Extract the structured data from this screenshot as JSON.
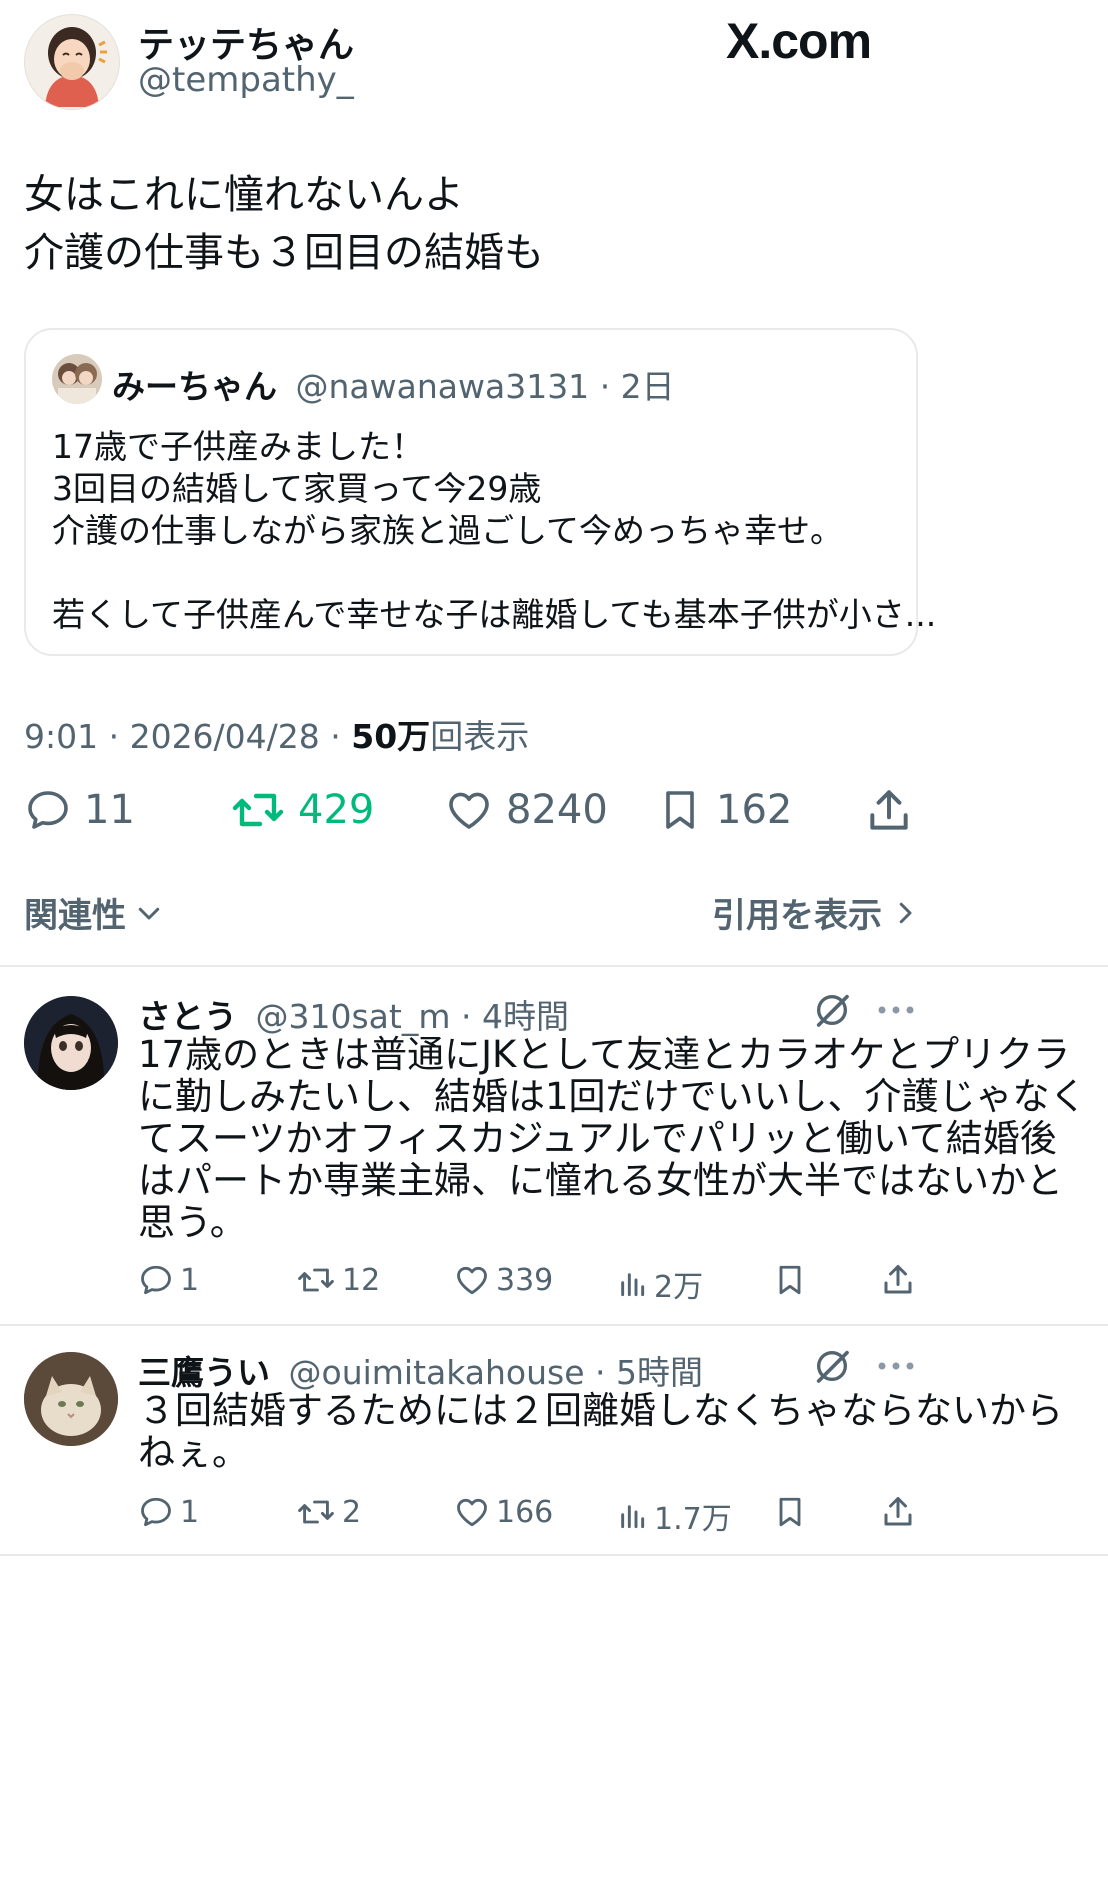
{
  "brand": {
    "logo_text": "X.com"
  },
  "post": {
    "author": {
      "name": "テッテちゃん",
      "handle": "@tempathy_"
    },
    "text_lines": [
      "女はこれに憧れないんよ",
      "介護の仕事も３回目の結婚も"
    ],
    "quote": {
      "name": "みーちゃん",
      "handle": "@nawanawa3131",
      "time": "· 2日",
      "lines": [
        "17歳で子供産みました！",
        "3回目の結婚して家買って今29歳",
        "介護の仕事しながら家族と過ごして今めっちゃ幸せ。",
        "若くして子供産んで幸せな子は離婚しても基本子供が小さ..."
      ]
    },
    "timestamp": "9:01 · 2026/04/28 · ",
    "views_count": "50万",
    "views_label": "回表示",
    "stats": {
      "replies": "11",
      "reposts": "429",
      "likes": "8240",
      "bookmarks": "162"
    },
    "sort_label": "関連性",
    "quotes_link": "引用を表示"
  },
  "replies": [
    {
      "name": "さとう",
      "handle": "@310sat_m",
      "time": "· 4時間",
      "lines": [
        "17歳のときは普通にJKとして友達とカラオケとプリクラ",
        "に勤しみたいし、結婚は1回だけでいいし、介護じゃなく",
        "てスーツかオフィスカジュアルでパリッと働いて結婚後",
        "はパートか専業主婦、に憧れる女性が大半ではないかと",
        "思う。"
      ],
      "stats": {
        "replies": "1",
        "reposts": "12",
        "likes": "339",
        "views": "2万"
      }
    },
    {
      "name": "三鷹うい",
      "handle": "@ouimitakahouse",
      "time": "· 5時間",
      "lines": [
        "３回結婚するためには２回離婚しなくちゃならないから",
        "ねぇ。"
      ],
      "stats": {
        "replies": "1",
        "reposts": "2",
        "likes": "166",
        "views": "1.7万"
      }
    }
  ],
  "colors": {
    "text": "#0f1419",
    "muted": "#536471",
    "repost_active": "#00ba7c",
    "border": "#e7e9ea"
  }
}
